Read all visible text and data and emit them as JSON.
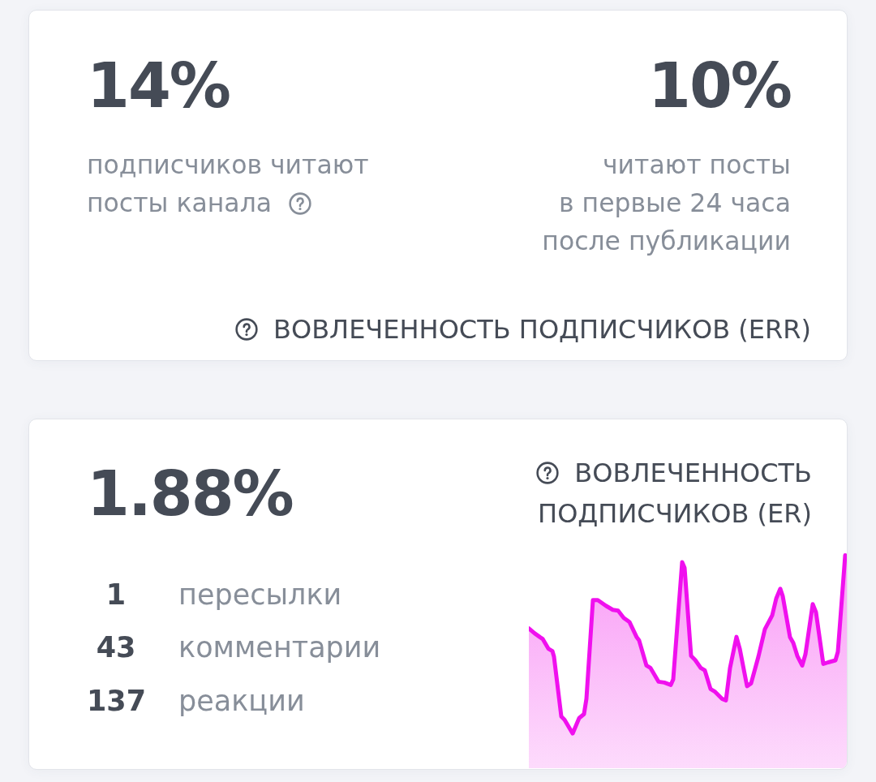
{
  "reach_card": {
    "metrics": [
      {
        "value": "14%",
        "description_lines": [
          "подписчиков читают",
          "посты канала"
        ],
        "help_icon": true
      },
      {
        "value": "10%",
        "description_lines": [
          "читают посты",
          "в первые 24 часа",
          "после публикации"
        ],
        "help_icon": false
      }
    ],
    "title": {
      "text": "ВОВЛЕЧЕННОСТЬ ПОДПИСЧИКОВ (ERR)",
      "help_icon": true
    }
  },
  "er_card": {
    "value": "1.88%",
    "stats": [
      {
        "count": "1",
        "label": "пересылки"
      },
      {
        "count": "43",
        "label": "комментарии"
      },
      {
        "count": "137",
        "label": "реакции"
      }
    ],
    "title": {
      "lines": [
        "ВОВЛЕЧЕННОСТЬ",
        "ПОДПИСЧИКОВ (ER)"
      ],
      "help_icon": true
    }
  }
}
